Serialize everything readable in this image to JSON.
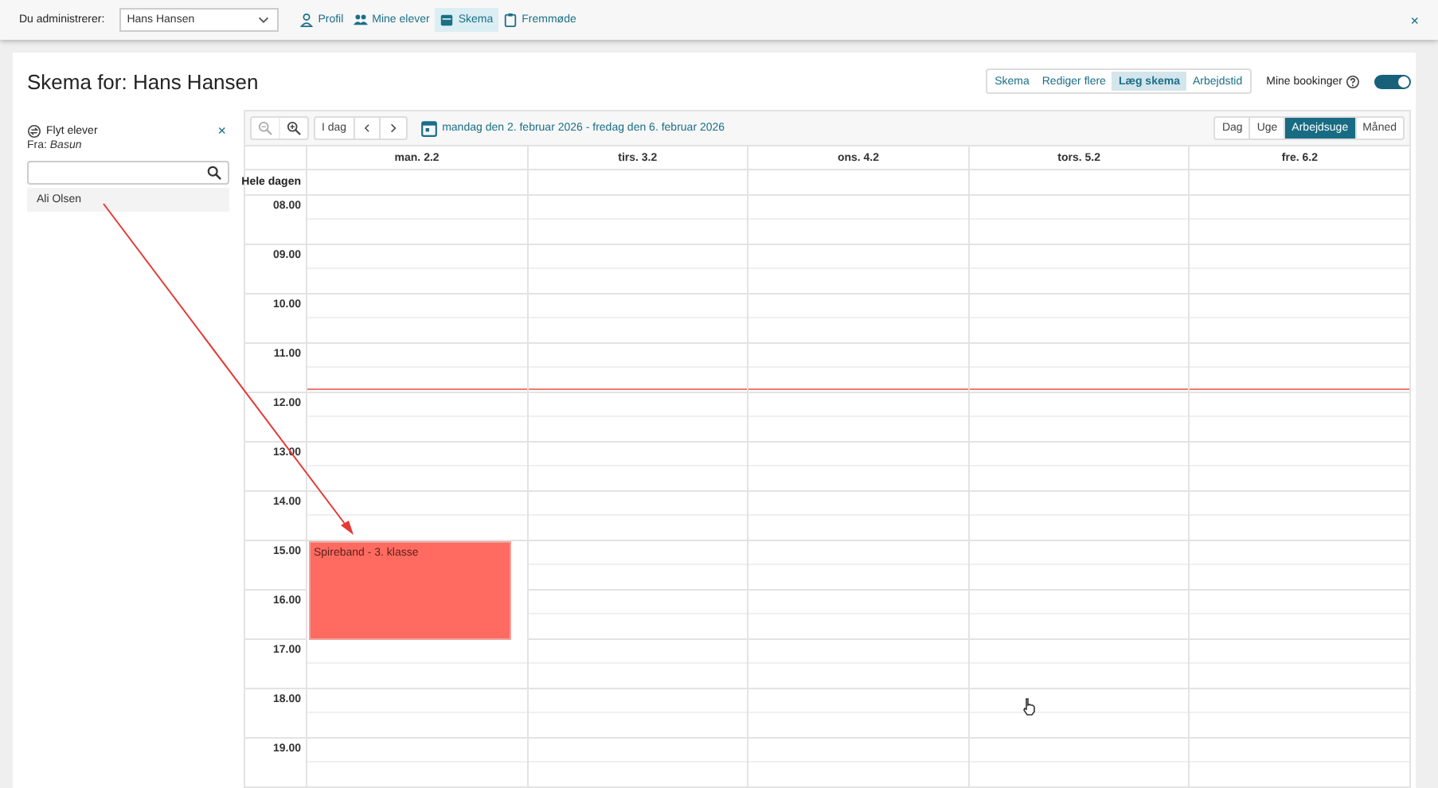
{
  "top_bar": {
    "label": "Du administrerer:",
    "user_select": {
      "value": "Hans Hansen"
    },
    "nav": [
      {
        "kind": "person",
        "label": "Profil",
        "selected": false
      },
      {
        "kind": "group",
        "label": "Mine elever",
        "selected": false
      },
      {
        "kind": "calendar",
        "label": "Skema",
        "selected": true
      },
      {
        "kind": "clipboard",
        "label": "Fremmøde",
        "selected": false
      }
    ],
    "close": "×"
  },
  "page": {
    "title": "Skema for: Hans Hansen",
    "modes": [
      {
        "label": "Skema",
        "selected": false
      },
      {
        "label": "Rediger flere",
        "selected": false
      },
      {
        "label": "Læg skema",
        "selected": true
      },
      {
        "label": "Arbejdstid",
        "selected": false
      }
    ],
    "my_bookings": {
      "label": "Mine bookinger",
      "on": true
    }
  },
  "move_panel": {
    "title": "Flyt elever",
    "close": "×",
    "from": "Fra: *Basun*",
    "students": [
      {
        "name": "Ali Olsen"
      }
    ]
  },
  "calendar": {
    "zoom_out": {
      "disabled": true
    },
    "zoom_in": {
      "disabled": false
    },
    "today": "I dag",
    "range": "mandag den 2. februar 2026 - fredag den 6. februar 2026",
    "views": [
      {
        "label": "Dag",
        "selected": false
      },
      {
        "label": "Uge",
        "selected": false
      },
      {
        "label": "Arbejdsuge",
        "selected": true
      },
      {
        "label": "Måned",
        "selected": false
      }
    ],
    "all_day_label": "Hele dagen",
    "days": [
      {
        "label": "man. 2.2",
        "event": {
          "title": "Spireband - 3. klasse"
        }
      },
      {
        "label": "tirs. 3.2"
      },
      {
        "label": "ons. 4.2"
      },
      {
        "label": "tors. 5.2"
      },
      {
        "label": "fre. 6.2"
      }
    ],
    "hours": [
      {
        "label": "08.00",
        "booked": [
          false,
          false,
          false,
          false,
          false
        ]
      },
      {
        "label": "09.00",
        "booked": [
          false,
          false,
          false,
          false,
          false
        ]
      },
      {
        "label": "10.00",
        "booked": [
          false,
          false,
          false,
          false,
          false
        ]
      },
      {
        "label": "11.00",
        "booked": [
          false,
          false,
          false,
          false,
          false
        ],
        "current_time": true
      },
      {
        "label": "12.00",
        "booked": [
          false,
          false,
          false,
          false,
          false
        ]
      },
      {
        "label": "13.00",
        "booked": [
          false,
          false,
          false,
          false,
          false
        ]
      },
      {
        "label": "14.00",
        "booked": [
          false,
          false,
          false,
          false,
          false
        ]
      },
      {
        "label": "15.00",
        "booked": [
          true,
          false,
          false,
          false,
          false
        ]
      },
      {
        "label": "16.00",
        "booked": [
          true,
          false,
          false,
          false,
          false
        ]
      },
      {
        "label": "17.00",
        "booked": [
          false,
          false,
          false,
          false,
          false
        ]
      },
      {
        "label": "18.00",
        "booked": [
          false,
          false,
          false,
          false,
          false
        ]
      },
      {
        "label": "19.00",
        "booked": [
          false,
          false,
          false,
          false,
          false
        ]
      }
    ]
  }
}
